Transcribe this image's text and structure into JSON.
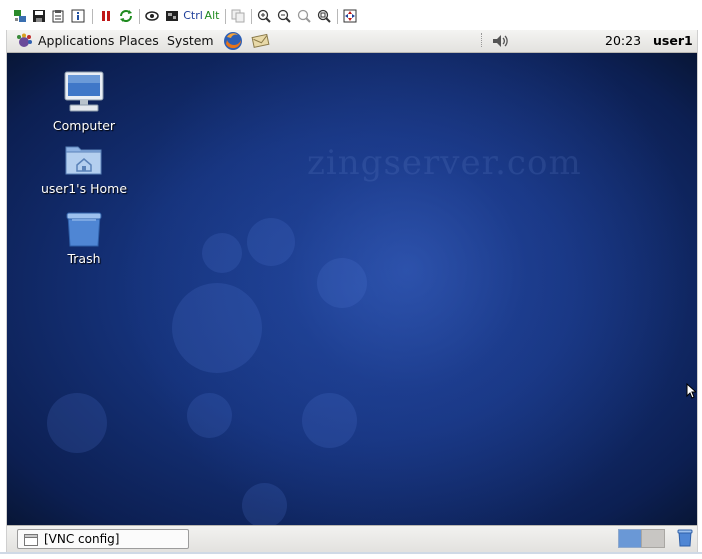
{
  "toolbar": {
    "buttons": [
      {
        "name": "connection-options-icon"
      },
      {
        "name": "save-icon"
      },
      {
        "name": "clipboard-icon"
      },
      {
        "name": "info-icon"
      },
      {
        "name": "pause-icon"
      },
      {
        "name": "refresh-icon"
      },
      {
        "name": "send-keys-icon"
      },
      {
        "name": "fullscreen-icon"
      },
      {
        "name": "ctrl-key-label",
        "text": "Ctrl"
      },
      {
        "name": "alt-key-label",
        "text": "Alt"
      },
      {
        "name": "copy-icon"
      },
      {
        "name": "zoom-in-icon"
      },
      {
        "name": "zoom-out-icon"
      },
      {
        "name": "zoom-100-icon"
      },
      {
        "name": "zoom-fit-icon"
      },
      {
        "name": "full-screen-toggle-icon"
      }
    ],
    "ctrl_label": "Ctrl",
    "alt_label": "Alt"
  },
  "top_panel": {
    "menus": [
      "Applications",
      "Places",
      "System"
    ],
    "clock": "20:23",
    "user": "user1",
    "launchers": [
      "firefox-icon",
      "mail-icon"
    ],
    "tray": [
      "volume-icon"
    ]
  },
  "desktop": {
    "watermark": "zingserver.com",
    "icons": [
      {
        "label": "Computer",
        "icon": "computer-icon"
      },
      {
        "label": "user1's Home",
        "icon": "home-folder-icon"
      },
      {
        "label": "Trash",
        "icon": "trash-icon"
      }
    ]
  },
  "bottom_panel": {
    "task": "[VNC config]",
    "workspaces": 2,
    "active_workspace": 1
  },
  "colors": {
    "desktop_bg": "#1c3f8e",
    "panel_bg": "#e9e8e5",
    "workspace_active": "#6a98d6"
  }
}
